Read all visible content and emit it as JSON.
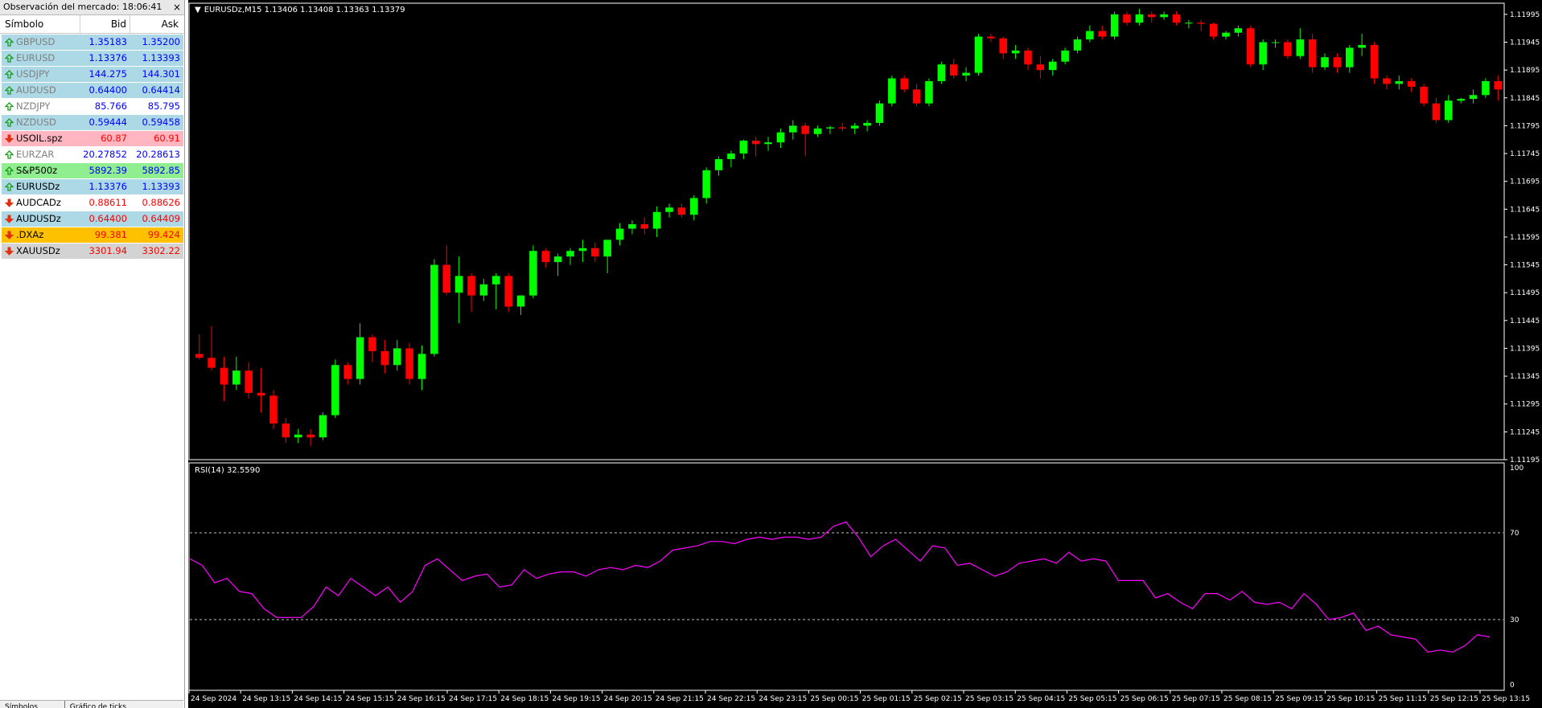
{
  "market_watch": {
    "title": "Observación del mercado: 18:06:41",
    "close_glyph": "×",
    "columns": {
      "symbol": "Símbolo",
      "bid": "Bid",
      "ask": "Ask"
    },
    "rows": [
      {
        "symbol": "GBPUSD",
        "bid": "1.35183",
        "ask": "1.35200",
        "bg": "#add8e6",
        "sym_color": "#808080",
        "bid_color": "#0000ff",
        "ask_color": "#0000ff",
        "dir": "up"
      },
      {
        "symbol": "EURUSD",
        "bid": "1.13376",
        "ask": "1.13393",
        "bg": "#add8e6",
        "sym_color": "#808080",
        "bid_color": "#0000ff",
        "ask_color": "#0000ff",
        "dir": "up"
      },
      {
        "symbol": "USDJPY",
        "bid": "144.275",
        "ask": "144.301",
        "bg": "#add8e6",
        "sym_color": "#808080",
        "bid_color": "#0000ff",
        "ask_color": "#0000ff",
        "dir": "up"
      },
      {
        "symbol": "AUDUSD",
        "bid": "0.64400",
        "ask": "0.64414",
        "bg": "#add8e6",
        "sym_color": "#808080",
        "bid_color": "#0000ff",
        "ask_color": "#0000ff",
        "dir": "up"
      },
      {
        "symbol": "NZDJPY",
        "bid": "85.766",
        "ask": "85.795",
        "bg": "#ffffff",
        "sym_color": "#808080",
        "bid_color": "#0000ff",
        "ask_color": "#0000ff",
        "dir": "up"
      },
      {
        "symbol": "NZDUSD",
        "bid": "0.59444",
        "ask": "0.59458",
        "bg": "#add8e6",
        "sym_color": "#808080",
        "bid_color": "#0000ff",
        "ask_color": "#0000ff",
        "dir": "up"
      },
      {
        "symbol": "USOIL.spz",
        "bid": "60.87",
        "ask": "60.91",
        "bg": "#ffb6c1",
        "sym_color": "#000000",
        "bid_color": "#ff0000",
        "ask_color": "#ff0000",
        "dir": "down"
      },
      {
        "symbol": "EURZAR",
        "bid": "20.27852",
        "ask": "20.28613",
        "bg": "#ffffff",
        "sym_color": "#808080",
        "bid_color": "#0000ff",
        "ask_color": "#0000ff",
        "dir": "up"
      },
      {
        "symbol": "S&P500z",
        "bid": "5892.39",
        "ask": "5892.85",
        "bg": "#90ee90",
        "sym_color": "#000000",
        "bid_color": "#0000ff",
        "ask_color": "#0000ff",
        "dir": "up"
      },
      {
        "symbol": "EURUSDz",
        "bid": "1.13376",
        "ask": "1.13393",
        "bg": "#add8e6",
        "sym_color": "#000000",
        "bid_color": "#0000ff",
        "ask_color": "#0000ff",
        "dir": "up"
      },
      {
        "symbol": "AUDCADz",
        "bid": "0.88611",
        "ask": "0.88626",
        "bg": "#ffffff",
        "sym_color": "#000000",
        "bid_color": "#ff0000",
        "ask_color": "#ff0000",
        "dir": "down"
      },
      {
        "symbol": "AUDUSDz",
        "bid": "0.64400",
        "ask": "0.64409",
        "bg": "#add8e6",
        "sym_color": "#000000",
        "bid_color": "#ff0000",
        "ask_color": "#ff0000",
        "dir": "down"
      },
      {
        "symbol": ".DXAz",
        "bid": "99.381",
        "ask": "99.424",
        "bg": "#ffc000",
        "sym_color": "#000000",
        "bid_color": "#ff0000",
        "ask_color": "#ff0000",
        "dir": "down"
      },
      {
        "symbol": "XAUUSDz",
        "bid": "3301.94",
        "ask": "3302.22",
        "bg": "#d3d3d3",
        "sym_color": "#000000",
        "bid_color": "#ff0000",
        "ask_color": "#ff0000",
        "dir": "down"
      }
    ],
    "tabs": [
      "Símbolos",
      "Gráfico de ticks"
    ]
  },
  "chart": {
    "title": "EURUSDz,M15  1.13406 1.13408 1.13363 1.13379",
    "rsi_title": "RSI(14) 32.5590",
    "colors": {
      "up": "#00ff00",
      "down": "#ff0000",
      "rsi": "#ff00ff",
      "bg": "#000000",
      "fg": "#ffffff"
    }
  },
  "chart_data": {
    "type": "candlestick",
    "price_ticks": [
      "1.11995",
      "1.11945",
      "1.11895",
      "1.11845",
      "1.11795",
      "1.11745",
      "1.11695",
      "1.11645",
      "1.11595",
      "1.11545",
      "1.11495",
      "1.11445",
      "1.11395",
      "1.11345",
      "1.11295",
      "1.11245",
      "1.11195"
    ],
    "rsi_ticks": [
      "100",
      "70",
      "30",
      "0"
    ],
    "rsi_levels": [
      70,
      30
    ],
    "time_ticks": [
      "24 Sep 2024",
      "24 Sep 13:15",
      "24 Sep 14:15",
      "24 Sep 15:15",
      "24 Sep 16:15",
      "24 Sep 17:15",
      "24 Sep 18:15",
      "24 Sep 19:15",
      "24 Sep 20:15",
      "24 Sep 21:15",
      "24 Sep 22:15",
      "24 Sep 23:15",
      "25 Sep 00:15",
      "25 Sep 01:15",
      "25 Sep 02:15",
      "25 Sep 03:15",
      "25 Sep 04:15",
      "25 Sep 05:15",
      "25 Sep 06:15",
      "25 Sep 07:15",
      "25 Sep 08:15",
      "25 Sep 09:15",
      "25 Sep 10:15",
      "25 Sep 11:15",
      "25 Sep 12:15",
      "25 Sep 13:15"
    ],
    "price_range": [
      1.11195,
      1.12015
    ],
    "candles": [
      [
        1.11385,
        1.1142,
        1.11375,
        1.11378
      ],
      [
        1.11378,
        1.11435,
        1.11355,
        1.1136
      ],
      [
        1.1136,
        1.1138,
        1.113,
        1.1133
      ],
      [
        1.1133,
        1.1138,
        1.1132,
        1.11355
      ],
      [
        1.11355,
        1.1137,
        1.11305,
        1.11315
      ],
      [
        1.11315,
        1.1136,
        1.1128,
        1.1131
      ],
      [
        1.1131,
        1.1132,
        1.1125,
        1.1126
      ],
      [
        1.1126,
        1.1127,
        1.11225,
        1.11235
      ],
      [
        1.11235,
        1.1125,
        1.11225,
        1.1124
      ],
      [
        1.1124,
        1.1125,
        1.1122,
        1.11235
      ],
      [
        1.11235,
        1.1128,
        1.1123,
        1.11275
      ],
      [
        1.11275,
        1.11375,
        1.1127,
        1.11365
      ],
      [
        1.11365,
        1.1137,
        1.1133,
        1.1134
      ],
      [
        1.1134,
        1.1144,
        1.1133,
        1.11415
      ],
      [
        1.11415,
        1.1142,
        1.1137,
        1.1139
      ],
      [
        1.1139,
        1.1141,
        1.1135,
        1.11365
      ],
      [
        1.11365,
        1.1141,
        1.11355,
        1.11395
      ],
      [
        1.11395,
        1.11405,
        1.1133,
        1.1134
      ],
      [
        1.1134,
        1.114,
        1.1132,
        1.11385
      ],
      [
        1.11385,
        1.11555,
        1.1138,
        1.11545
      ],
      [
        1.11545,
        1.1158,
        1.1149,
        1.11495
      ],
      [
        1.11495,
        1.1156,
        1.1144,
        1.11525
      ],
      [
        1.11525,
        1.1153,
        1.1146,
        1.1149
      ],
      [
        1.1149,
        1.1152,
        1.1148,
        1.1151
      ],
      [
        1.1151,
        1.1153,
        1.11465,
        1.11525
      ],
      [
        1.11525,
        1.1153,
        1.1146,
        1.1147
      ],
      [
        1.1147,
        1.1149,
        1.11455,
        1.1149
      ],
      [
        1.1149,
        1.1158,
        1.11485,
        1.1157
      ],
      [
        1.1157,
        1.11575,
        1.1154,
        1.1155
      ],
      [
        1.1155,
        1.11565,
        1.11525,
        1.1156
      ],
      [
        1.1156,
        1.11575,
        1.11545,
        1.1157
      ],
      [
        1.1157,
        1.1159,
        1.1155,
        1.11575
      ],
      [
        1.11575,
        1.11585,
        1.1155,
        1.1156
      ],
      [
        1.1156,
        1.1159,
        1.1153,
        1.1159
      ],
      [
        1.1159,
        1.1162,
        1.1158,
        1.1161
      ],
      [
        1.1161,
        1.11625,
        1.116,
        1.11618
      ],
      [
        1.11618,
        1.1163,
        1.116,
        1.1161
      ],
      [
        1.1161,
        1.1165,
        1.11595,
        1.1164
      ],
      [
        1.1164,
        1.11655,
        1.1163,
        1.11648
      ],
      [
        1.11648,
        1.11655,
        1.1163,
        1.11635
      ],
      [
        1.11635,
        1.1167,
        1.11625,
        1.11665
      ],
      [
        1.11665,
        1.1172,
        1.11655,
        1.11715
      ],
      [
        1.11715,
        1.1174,
        1.11705,
        1.11735
      ],
      [
        1.11735,
        1.1175,
        1.1172,
        1.11745
      ],
      [
        1.11745,
        1.1177,
        1.11735,
        1.11768
      ],
      [
        1.11768,
        1.11775,
        1.1174,
        1.11762
      ],
      [
        1.11762,
        1.11775,
        1.1175,
        1.11765
      ],
      [
        1.11765,
        1.1179,
        1.11755,
        1.11783
      ],
      [
        1.11783,
        1.11805,
        1.1177,
        1.11795
      ],
      [
        1.11795,
        1.118,
        1.1174,
        1.1178
      ],
      [
        1.1178,
        1.11795,
        1.11775,
        1.1179
      ],
      [
        1.1179,
        1.11795,
        1.1178,
        1.11792
      ],
      [
        1.11792,
        1.118,
        1.11785,
        1.1179
      ],
      [
        1.1179,
        1.118,
        1.1178,
        1.11795
      ],
      [
        1.11795,
        1.11805,
        1.11785,
        1.118
      ],
      [
        1.118,
        1.1184,
        1.11795,
        1.11835
      ],
      [
        1.11835,
        1.11885,
        1.1183,
        1.1188
      ],
      [
        1.1188,
        1.11885,
        1.11855,
        1.1186
      ],
      [
        1.1186,
        1.1187,
        1.1183,
        1.11835
      ],
      [
        1.11835,
        1.1188,
        1.1183,
        1.11875
      ],
      [
        1.11875,
        1.1191,
        1.1187,
        1.11905
      ],
      [
        1.11905,
        1.11915,
        1.1188,
        1.11885
      ],
      [
        1.11885,
        1.119,
        1.11875,
        1.1189
      ],
      [
        1.1189,
        1.1196,
        1.11885,
        1.11955
      ],
      [
        1.11955,
        1.1196,
        1.11945,
        1.11952
      ],
      [
        1.11952,
        1.11955,
        1.11915,
        1.11925
      ],
      [
        1.11925,
        1.1194,
        1.11915,
        1.1193
      ],
      [
        1.1193,
        1.11935,
        1.11895,
        1.11905
      ],
      [
        1.11905,
        1.1192,
        1.1188,
        1.11895
      ],
      [
        1.11895,
        1.11915,
        1.11885,
        1.1191
      ],
      [
        1.1191,
        1.11935,
        1.11905,
        1.1193
      ],
      [
        1.1193,
        1.11955,
        1.11925,
        1.1195
      ],
      [
        1.1195,
        1.11975,
        1.11945,
        1.11965
      ],
      [
        1.11965,
        1.11975,
        1.1195,
        1.11955
      ],
      [
        1.11955,
        1.12,
        1.1195,
        1.11995
      ],
      [
        1.11995,
        1.12,
        1.11975,
        1.1198
      ],
      [
        1.1198,
        1.12005,
        1.11975,
        1.11995
      ],
      [
        1.11995,
        1.12,
        1.1198,
        1.1199
      ],
      [
        1.1199,
        1.12,
        1.11985,
        1.11995
      ],
      [
        1.11995,
        1.12,
        1.11975,
        1.1198
      ],
      [
        1.1198,
        1.11985,
        1.1197,
        1.1198
      ],
      [
        1.1198,
        1.11985,
        1.11965,
        1.11978
      ],
      [
        1.11978,
        1.1198,
        1.1195,
        1.11955
      ],
      [
        1.11955,
        1.11965,
        1.1195,
        1.11962
      ],
      [
        1.11962,
        1.11975,
        1.11955,
        1.1197
      ],
      [
        1.1197,
        1.11975,
        1.119,
        1.11905
      ],
      [
        1.11905,
        1.1195,
        1.11895,
        1.11945
      ],
      [
        1.11945,
        1.1195,
        1.11935,
        1.11945
      ],
      [
        1.11945,
        1.1195,
        1.11915,
        1.1192
      ],
      [
        1.1192,
        1.1197,
        1.11915,
        1.1195
      ],
      [
        1.1195,
        1.1196,
        1.1189,
        1.119
      ],
      [
        1.119,
        1.11925,
        1.11895,
        1.11918
      ],
      [
        1.11918,
        1.11925,
        1.1189,
        1.119
      ],
      [
        1.119,
        1.1194,
        1.1189,
        1.11935
      ],
      [
        1.11935,
        1.1196,
        1.1192,
        1.1194
      ],
      [
        1.1194,
        1.11945,
        1.1187,
        1.1188
      ],
      [
        1.1188,
        1.11885,
        1.1186,
        1.1187
      ],
      [
        1.1187,
        1.11885,
        1.1186,
        1.11875
      ],
      [
        1.11875,
        1.1188,
        1.11855,
        1.11865
      ],
      [
        1.11865,
        1.1187,
        1.1183,
        1.11835
      ],
      [
        1.11835,
        1.11845,
        1.118,
        1.11805
      ],
      [
        1.11805,
        1.1185,
        1.118,
        1.1184
      ],
      [
        1.1184,
        1.11845,
        1.11835,
        1.11843
      ],
      [
        1.11843,
        1.1186,
        1.11835,
        1.1185
      ],
      [
        1.1185,
        1.1188,
        1.11845,
        1.11875
      ],
      [
        1.11875,
        1.11885,
        1.1184,
        1.1186
      ]
    ],
    "rsi": [
      58,
      55,
      47,
      49,
      43,
      42,
      35,
      31,
      31,
      31,
      36,
      45,
      41,
      49,
      45,
      41,
      45,
      38,
      43,
      55,
      58,
      53,
      48,
      50,
      51,
      45,
      46,
      53,
      49,
      51,
      52,
      52,
      50,
      53,
      54,
      53,
      55,
      54,
      57,
      62,
      63,
      64,
      66,
      66,
      65,
      67,
      68,
      67,
      68,
      68,
      67,
      68,
      73,
      75,
      68,
      59,
      64,
      67,
      62,
      57,
      64,
      63,
      55,
      56,
      53,
      50,
      52,
      56,
      57,
      58,
      56,
      61,
      57,
      58,
      57,
      48,
      48,
      48,
      40,
      42,
      38,
      35,
      42,
      42,
      39,
      43,
      38,
      37,
      38,
      35,
      42,
      37,
      30,
      31,
      33,
      25,
      27,
      23,
      22,
      21,
      15,
      16,
      15,
      18,
      23,
      22
    ],
    "rsi_first_value_note": ""
  }
}
